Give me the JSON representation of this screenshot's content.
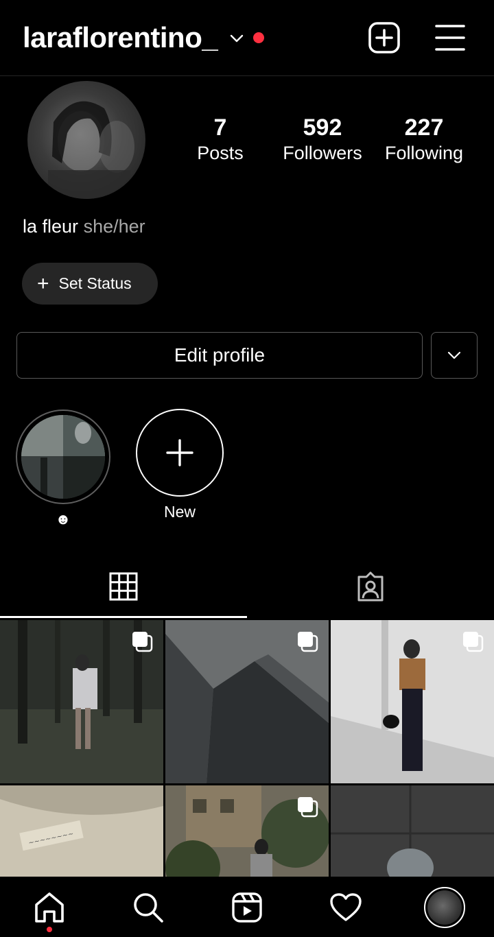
{
  "header": {
    "username": "larafl​orentino_"
  },
  "profile": {
    "stats": {
      "posts_count": "7",
      "posts_label": "Posts",
      "followers_count": "592",
      "followers_label": "Followers",
      "following_count": "227",
      "following_label": "Following"
    },
    "bio_name": "la fleur",
    "bio_pronouns": "she/her",
    "status_button_label": "Set Status",
    "edit_button_label": "Edit profile"
  },
  "highlights": [
    {
      "label": "☻"
    },
    {
      "label": "New"
    }
  ],
  "tabs": [
    "posts-grid-icon",
    "tagged-icon"
  ],
  "grid_posts": [
    {
      "scene": "forest walk",
      "multi": true
    },
    {
      "scene": "skyscraper",
      "multi": true
    },
    {
      "scene": "white wall portrait",
      "multi": true
    },
    {
      "scene": "tote bag",
      "multi": false
    },
    {
      "scene": "street building",
      "multi": true
    },
    {
      "scene": "tiled floor",
      "multi": false
    }
  ],
  "nav": [
    "home-icon",
    "search-icon",
    "reels-icon",
    "heart-icon",
    "profile-avatar"
  ],
  "colors": {
    "background": "#000000",
    "notification_red": "#ff3040",
    "chip_bg": "#262626",
    "muted_text": "#a8a8a8"
  }
}
